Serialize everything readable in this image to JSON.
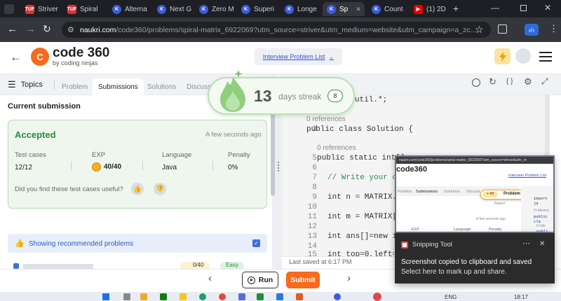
{
  "browser": {
    "tabs": [
      {
        "label": "Striver",
        "icon": "tuf-favicon"
      },
      {
        "label": "Spiral",
        "icon": "tuf-favicon"
      },
      {
        "label": "Alterna",
        "icon": "codingninjas-favicon"
      },
      {
        "label": "Next G",
        "icon": "codingninjas-favicon"
      },
      {
        "label": "Zero M",
        "icon": "codingninjas-favicon"
      },
      {
        "label": "Superi",
        "icon": "codingninjas-favicon"
      },
      {
        "label": "Longe",
        "icon": "codingninjas-favicon"
      },
      {
        "label": "Sp",
        "icon": "codingninjas-favicon",
        "active": true
      },
      {
        "label": "Count",
        "icon": "codingninjas-favicon"
      },
      {
        "label": "(1) 2D",
        "icon": "youtube-favicon"
      }
    ],
    "url_host": "naukri.com",
    "url_rest": "/code360/problems/spiral-matrix_6922069?utm_source=striver&utm_medium=website&utm_campaign=a_zc..."
  },
  "site": {
    "logo_title": "code 360",
    "logo_sub": "by coding ninjas",
    "interview_list": "Interview Problem List"
  },
  "left": {
    "topics": "Topics",
    "tabs": [
      "Problem",
      "Submissions",
      "Solutions",
      "Discuss"
    ],
    "current_submission": "Current submission",
    "status": "Accepted",
    "time": "A few seconds ago",
    "stats": {
      "test_cases_label": "Test cases",
      "test_cases": "12/12",
      "exp_label": "EXP",
      "exp": "40/40",
      "language_label": "Language",
      "language": "Java",
      "penalty_label": "Penalty",
      "penalty": "0%"
    },
    "useful_q": "Did you find these test cases useful?",
    "recommended": "Showing recommended problems",
    "rec_item_exp": "0/40",
    "rec_item_tag": "Easy"
  },
  "editor": {
    "code_lines": [
      {
        "n": "",
        "text": "util.*;"
      },
      {
        "n": "",
        "text": "0 references",
        "ref": true
      },
      {
        "n": "3",
        "text": "public class Solution {"
      },
      {
        "n": "",
        "text": "0 references",
        "ref": true
      },
      {
        "n": "5",
        "text": "public static int[] s"
      },
      {
        "n": "6",
        "text": ""
      },
      {
        "n": "7",
        "text": "// Write your cod"
      },
      {
        "n": "8",
        "text": ""
      },
      {
        "n": "9",
        "text": "int n = MATRIX.le"
      },
      {
        "n": "10",
        "text": ""
      },
      {
        "n": "11",
        "text": "int m = MATRIX[0"
      },
      {
        "n": "12",
        "text": ""
      },
      {
        "n": "13",
        "text": "int ans[]=new int"
      },
      {
        "n": "14",
        "text": ""
      },
      {
        "n": "15",
        "text": "int top=0,left=0,"
      }
    ],
    "saved": "Last saved at 6:17 PM"
  },
  "bottom": {
    "run": "Run",
    "submit": "Submit"
  },
  "streak": {
    "count": "13",
    "label": "days streak",
    "badge": "8"
  },
  "snip_thumb": {
    "url": "naukri.com/code360/problems/spiral-matrix_6922069?utm_source=striver&utm_m",
    "logo": "code360",
    "ip": "Interview Problem List",
    "tabs": [
      "Problem",
      "Submissions",
      "Solutions",
      "Discuss"
    ],
    "exp_badge": "+ 40",
    "problem_submitted": "Problem submitted",
    "report": "Report",
    "time": "A few seconds ago",
    "cols": [
      "EXP",
      "Language",
      "Penalty"
    ],
    "code_a": "import ja",
    "code_b": "0 referenc",
    "code_c": "public cla",
    "code_d": "0 refe",
    "code_e": "publi"
  },
  "toast": {
    "app": "Snipping Tool",
    "title": "Screenshot copied to clipboard and saved",
    "body": "Select here to mark up and share."
  },
  "taskbar": {
    "lang": "ENG",
    "time": "18:17"
  }
}
